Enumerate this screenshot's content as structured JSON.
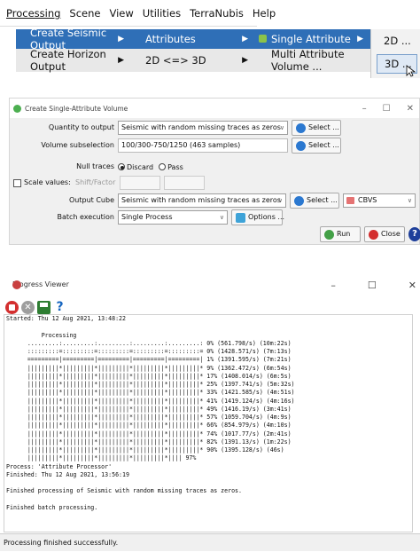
{
  "menubar": {
    "items": [
      "Processing",
      "Scene",
      "View",
      "Utilities",
      "TerraNubis",
      "Help"
    ]
  },
  "menus": {
    "processing": [
      "Create Seismic Output",
      "Create Horizon Output"
    ],
    "seismic_output": [
      "Attributes",
      "2D <=> 3D"
    ],
    "attributes": [
      "Single Attribute",
      "Multi Attribute Volume ..."
    ],
    "single_attribute": [
      "2D ...",
      "3D ..."
    ]
  },
  "dialog": {
    "title": "Create Single-Attribute Volume",
    "quantity_label": "Quantity to output",
    "quantity_value": "Seismic with random missing traces as zeros",
    "select_label": "Select ...",
    "subsel_label": "Volume subselection",
    "subsel_value": "100/300-750/1250 (463 samples)",
    "null_label": "Null traces",
    "null_options": [
      "Discard",
      "Pass"
    ],
    "scale_label": "Scale values:",
    "scale_placeholder": "Shift/Factor",
    "output_label": "Output Cube",
    "output_value": "Seismic with random missing traces as zeros",
    "cbvs_label": "CBVS",
    "batch_label": "Batch execution",
    "batch_value": "Single Process",
    "options_label": "Options ...",
    "run_label": "Run",
    "close_label": "Close",
    "help_label": "?"
  },
  "progress": {
    "title": "Progress Viewer",
    "log_lines": [
      "Started: Thu 12 Aug 2021, 13:48:22",
      "",
      "          Processing",
      "      .........:.........:.........:.........:.........: 0% (561.798/s) (10m:22s)",
      "      :::::::::=:::::::::=:::::::::=:::::::::=:::::::::= 0% (1428.571/s) (7m:13s)",
      "      =========|=========|=========|=========|=========| 1% (1391.595/s) (7m:21s)",
      "      |||||||||*|||||||||*|||||||||*|||||||||*|||||||||* 9% (1362.472/s) (6m:54s)",
      "      |||||||||*|||||||||*|||||||||*|||||||||*|||||||||* 17% (1408.014/s) (6m:5s)",
      "      |||||||||*|||||||||*|||||||||*|||||||||*|||||||||* 25% (1397.741/s) (5m:32s)",
      "      |||||||||*|||||||||*|||||||||*|||||||||*|||||||||* 33% (1421.585/s) (4m:51s)",
      "      |||||||||*|||||||||*|||||||||*|||||||||*|||||||||* 41% (1419.124/s) (4m:16s)",
      "      |||||||||*|||||||||*|||||||||*|||||||||*|||||||||* 49% (1416.19/s) (3m:41s)",
      "      |||||||||*|||||||||*|||||||||*|||||||||*|||||||||* 57% (1059.704/s) (4m:9s)",
      "      |||||||||*|||||||||*|||||||||*|||||||||*|||||||||* 66% (854.979/s) (4m:10s)",
      "      |||||||||*|||||||||*|||||||||*|||||||||*|||||||||* 74% (1017.77/s) (2m:41s)",
      "      |||||||||*|||||||||*|||||||||*|||||||||*|||||||||* 82% (1391.13/s) (1m:22s)",
      "      |||||||||*|||||||||*|||||||||*|||||||||*|||||||||* 90% (1395.128/s) (46s)",
      "      |||||||||*|||||||||*|||||||||*|||||||||*|||| 97%",
      "Process: 'Attribute Processor'",
      "Finished: Thu 12 Aug 2021, 13:56:19",
      "",
      "Finished processing of Seismic with random missing traces as zeros.",
      "",
      "Finished batch processing."
    ],
    "status": "Processing finished successfully."
  }
}
